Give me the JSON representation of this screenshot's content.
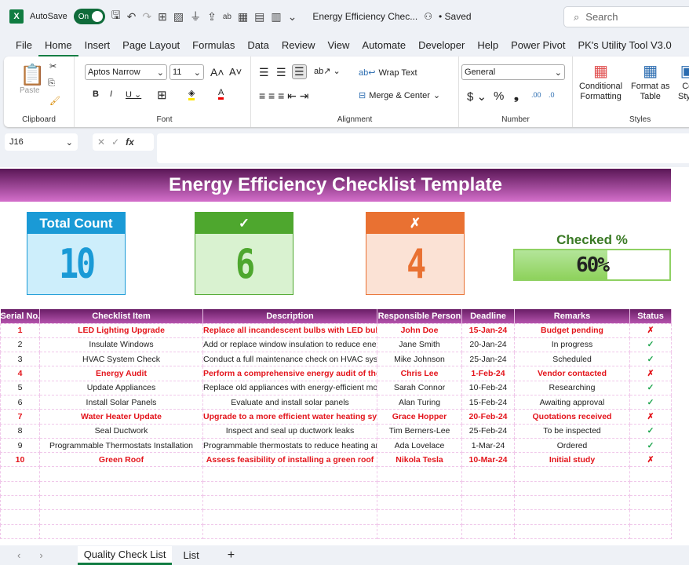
{
  "titlebar": {
    "autosave_label": "AutoSave",
    "toggle_label": "On",
    "doc_title": "Energy Efficiency Chec...",
    "saved": "• Saved",
    "search_placeholder": "Search"
  },
  "menu": [
    "File",
    "Home",
    "Insert",
    "Page Layout",
    "Formulas",
    "Data",
    "Review",
    "View",
    "Automate",
    "Developer",
    "Help",
    "Power Pivot",
    "PK's Utility Tool V3.0"
  ],
  "ribbon": {
    "paste": "Paste",
    "clipboard": "Clipboard",
    "font_name": "Aptos Narrow",
    "font_size": "11",
    "font": "Font",
    "wrap_text": "Wrap Text",
    "merge_center": "Merge & Center",
    "alignment": "Alignment",
    "number_format": "General",
    "number": "Number",
    "conditional": "Conditional",
    "formatting": "Formatting",
    "format_as": "Format as",
    "table": "Table",
    "cell": "Ce",
    "styles_short": "Style",
    "styles": "Styles"
  },
  "formula_bar": {
    "name_box": "J16",
    "formula": ""
  },
  "sheet": {
    "title": "Energy Efficiency Checklist Template",
    "cards": {
      "total_label": "Total Count",
      "total": "10",
      "checked_label": "✓",
      "checked": "6",
      "unchecked_label": "✗",
      "unchecked": "4"
    },
    "checked_pct_label": "Checked %",
    "checked_pct": "60%",
    "checked_fraction": 0.6,
    "colors": {
      "banner_dark": "#5a1656",
      "banner_light": "#d46fcb",
      "total": "#1a9ad6",
      "checked": "#4ea72e",
      "unchecked": "#e97132",
      "highlight": "#e3141b"
    },
    "columns": [
      "Serial No.",
      "Checklist Item",
      "Description",
      "Responsible Person",
      "Deadline",
      "Remarks",
      "Status"
    ],
    "rows": [
      [
        "1",
        "LED Lighting Upgrade",
        "Replace all incandescent bulbs with LED bulbs",
        "John Doe",
        "15-Jan-24",
        "Budget pending",
        "✗"
      ],
      [
        "2",
        "Insulate Windows",
        "Add or replace window insulation to reduce energy loss",
        "Jane Smith",
        "20-Jan-24",
        "In progress",
        "✓"
      ],
      [
        "3",
        "HVAC System Check",
        "Conduct a full maintenance check on HVAC system",
        "Mike Johnson",
        "25-Jan-24",
        "Scheduled",
        "✓"
      ],
      [
        "4",
        "Energy Audit",
        "Perform a comprehensive energy audit of the building",
        "Chris Lee",
        "1-Feb-24",
        "Vendor contacted",
        "✗"
      ],
      [
        "5",
        "Update Appliances",
        "Replace old appliances with energy-efficient models",
        "Sarah Connor",
        "10-Feb-24",
        "Researching",
        "✓"
      ],
      [
        "6",
        "Install Solar Panels",
        "Evaluate and install solar panels",
        "Alan Turing",
        "15-Feb-24",
        "Awaiting approval",
        "✓"
      ],
      [
        "7",
        "Water Heater Update",
        "Upgrade to a more efficient water heating system",
        "Grace Hopper",
        "20-Feb-24",
        "Quotations received",
        "✗"
      ],
      [
        "8",
        "Seal Ductwork",
        "Inspect and seal up ductwork leaks",
        "Tim Berners-Lee",
        "25-Feb-24",
        "To be inspected",
        "✓"
      ],
      [
        "9",
        "Programmable Thermostats Installation",
        "Programmable thermostats to reduce heating and cooling",
        "Ada Lovelace",
        "1-Mar-24",
        "Ordered",
        "✓"
      ],
      [
        "10",
        "Green Roof",
        "Assess feasibility of installing a green roof",
        "Nikola Tesla",
        "10-Mar-24",
        "Initial study",
        "✗"
      ]
    ]
  },
  "sheet_tabs": [
    "Quality Check List",
    "List"
  ]
}
